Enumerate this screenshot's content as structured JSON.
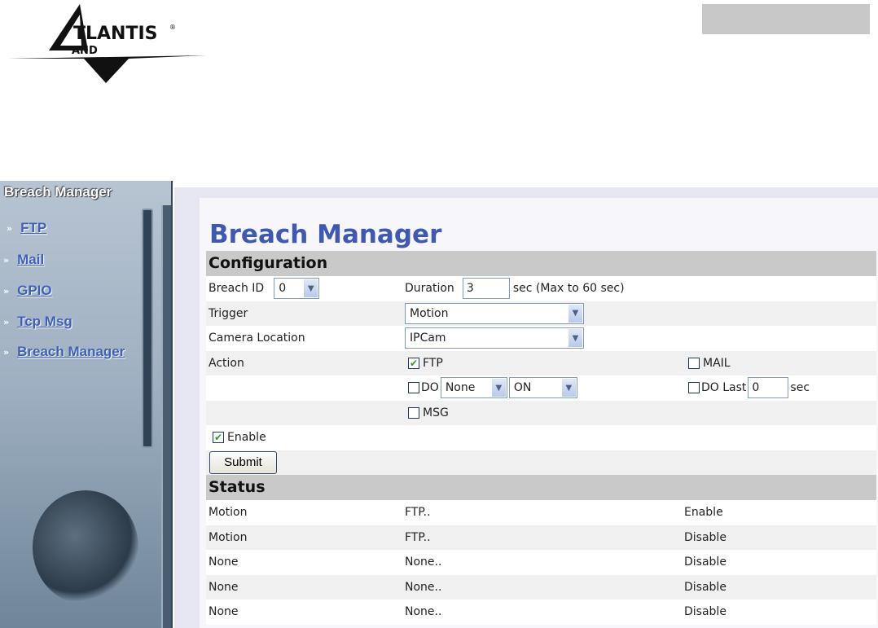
{
  "logo": {
    "text": "ATLANTIS LAND"
  },
  "sidebar": {
    "title": "Breach Manager",
    "items": [
      {
        "label": "FTP"
      },
      {
        "label": "Mail"
      },
      {
        "label": "GPIO"
      },
      {
        "label": "Tcp Msg"
      },
      {
        "label": "Breach Manager"
      }
    ],
    "arrow": "»"
  },
  "page_title": "Breach Manager",
  "config": {
    "header": "Configuration",
    "breach_id_label": "Breach ID",
    "breach_id_value": "0",
    "duration_label": "Duration",
    "duration_value": "3",
    "duration_hint": "sec (Max to 60 sec)",
    "trigger_label": "Trigger",
    "trigger_value": "Motion",
    "camera_label": "Camera Location",
    "camera_value": "IPCam",
    "action_label": "Action",
    "ftp_label": "FTP",
    "ftp_checked": true,
    "mail_label": "MAIL",
    "mail_checked": false,
    "do_label": "DO",
    "do_checked": false,
    "do_select": "None",
    "do_state": "ON",
    "do_last_label": "DO Last",
    "do_last_value": "0",
    "do_last_unit": "sec",
    "do_last_checked": false,
    "msg_label": "MSG",
    "msg_checked": false,
    "enable_label": "Enable",
    "enable_checked": true,
    "submit_label": "Submit"
  },
  "status": {
    "header": "Status",
    "rows": [
      [
        "Motion",
        "FTP..",
        "Enable"
      ],
      [
        "Motion",
        "FTP..",
        "Disable"
      ],
      [
        "None",
        "None..",
        "Disable"
      ],
      [
        "None",
        "None..",
        "Disable"
      ],
      [
        "None",
        "None..",
        "Disable"
      ]
    ]
  },
  "check_glyph": "✔",
  "chevron_glyph": "▼"
}
